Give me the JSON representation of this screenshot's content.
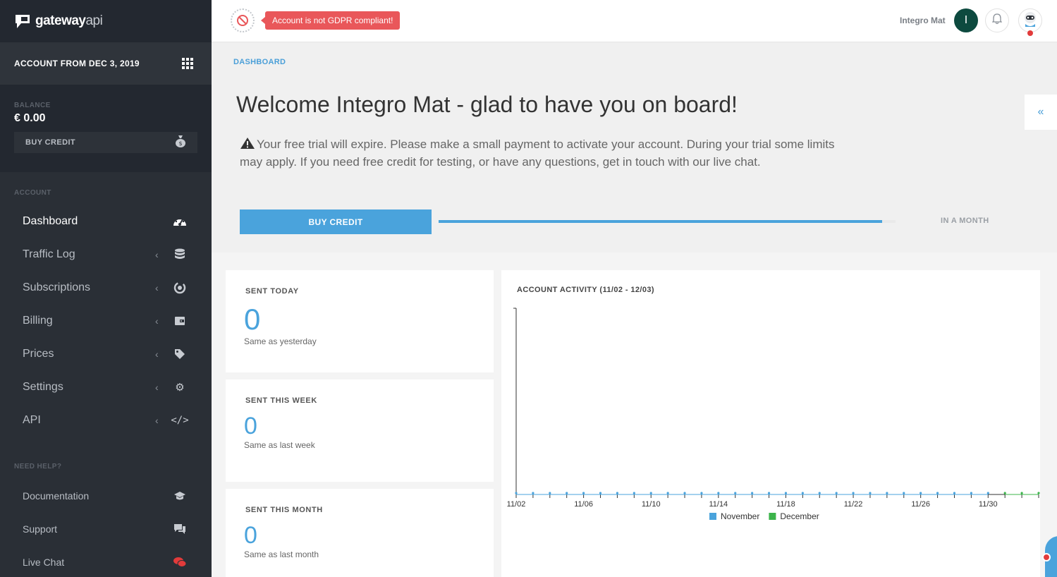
{
  "brand": {
    "name_bold": "gateway",
    "name_light": "api"
  },
  "sidebar": {
    "account_title": "ACCOUNT FROM DEC 3, 2019",
    "balance_label": "BALANCE",
    "balance_value": "€ 0.00",
    "buy_credit_label": "BUY CREDIT",
    "section_account": "ACCOUNT",
    "nav": [
      {
        "label": "Dashboard",
        "icon": "dashboard-gauge-icon",
        "active": true
      },
      {
        "label": "Traffic Log",
        "icon": "database-icon"
      },
      {
        "label": "Subscriptions",
        "icon": "subscriptions-icon"
      },
      {
        "label": "Billing",
        "icon": "wallet-icon"
      },
      {
        "label": "Prices",
        "icon": "tag-icon"
      },
      {
        "label": "Settings",
        "icon": "gear-icon"
      },
      {
        "label": "API",
        "icon": "code-icon"
      }
    ],
    "section_help": "NEED HELP?",
    "help": [
      {
        "label": "Documentation",
        "icon": "graduation-cap-icon"
      },
      {
        "label": "Support",
        "icon": "chat-bubbles-icon"
      },
      {
        "label": "Live Chat",
        "icon": "live-chat-icon",
        "icon_color": "#e23b3b"
      }
    ]
  },
  "topbar": {
    "gdpr_warning": "Account is not GDPR compliant!",
    "user_name": "Integro Mat",
    "avatar_initial": "I",
    "avatar_color": "#0d4a3f"
  },
  "hero": {
    "breadcrumb": "DASHBOARD",
    "welcome": "Welcome Integro Mat - glad to have you on board!",
    "trial_message": "Your free trial will expire. Please make a small payment to activate your account. During your trial some limits may apply. If you need free credit for testing, or have any questions, get in touch with our live chat.",
    "buy_credit_label": "BUY CREDIT",
    "trial_progress": 0.97,
    "expiry_label": "IN A MONTH"
  },
  "stats": [
    {
      "title": "SENT TODAY",
      "value": "0",
      "note": "Same as yesterday"
    },
    {
      "title": "SENT THIS WEEK",
      "value": "0",
      "note": "Same as last week"
    },
    {
      "title": "SENT THIS MONTH",
      "value": "0",
      "note": "Same as last month"
    }
  ],
  "chart": {
    "title": "ACCOUNT ACTIVITY (11/02 - 12/03)"
  },
  "chart_data": {
    "type": "line",
    "title": "ACCOUNT ACTIVITY (11/02 - 12/03)",
    "x": [
      "11/02",
      "11/03",
      "11/04",
      "11/05",
      "11/06",
      "11/07",
      "11/08",
      "11/09",
      "11/10",
      "11/11",
      "11/12",
      "11/13",
      "11/14",
      "11/15",
      "11/16",
      "11/17",
      "11/18",
      "11/19",
      "11/20",
      "11/21",
      "11/22",
      "11/23",
      "11/24",
      "11/25",
      "11/26",
      "11/27",
      "11/28",
      "11/29",
      "11/30",
      "12/01",
      "12/02",
      "12/03"
    ],
    "x_tick_labels": [
      "11/02",
      "11/06",
      "11/10",
      "11/14",
      "11/18",
      "11/22",
      "11/26",
      "11/30"
    ],
    "series": [
      {
        "name": "November",
        "color": "#4aa3dc",
        "values": [
          0,
          0,
          0,
          0,
          0,
          0,
          0,
          0,
          0,
          0,
          0,
          0,
          0,
          0,
          0,
          0,
          0,
          0,
          0,
          0,
          0,
          0,
          0,
          0,
          0,
          0,
          0,
          0,
          0,
          null,
          null,
          null
        ]
      },
      {
        "name": "December",
        "color": "#3cb44b",
        "values": [
          null,
          null,
          null,
          null,
          null,
          null,
          null,
          null,
          null,
          null,
          null,
          null,
          null,
          null,
          null,
          null,
          null,
          null,
          null,
          null,
          null,
          null,
          null,
          null,
          null,
          null,
          null,
          null,
          null,
          0,
          0,
          0
        ]
      }
    ],
    "ylim": [
      0,
      1
    ],
    "grid": false,
    "legend": "bottom-center"
  }
}
